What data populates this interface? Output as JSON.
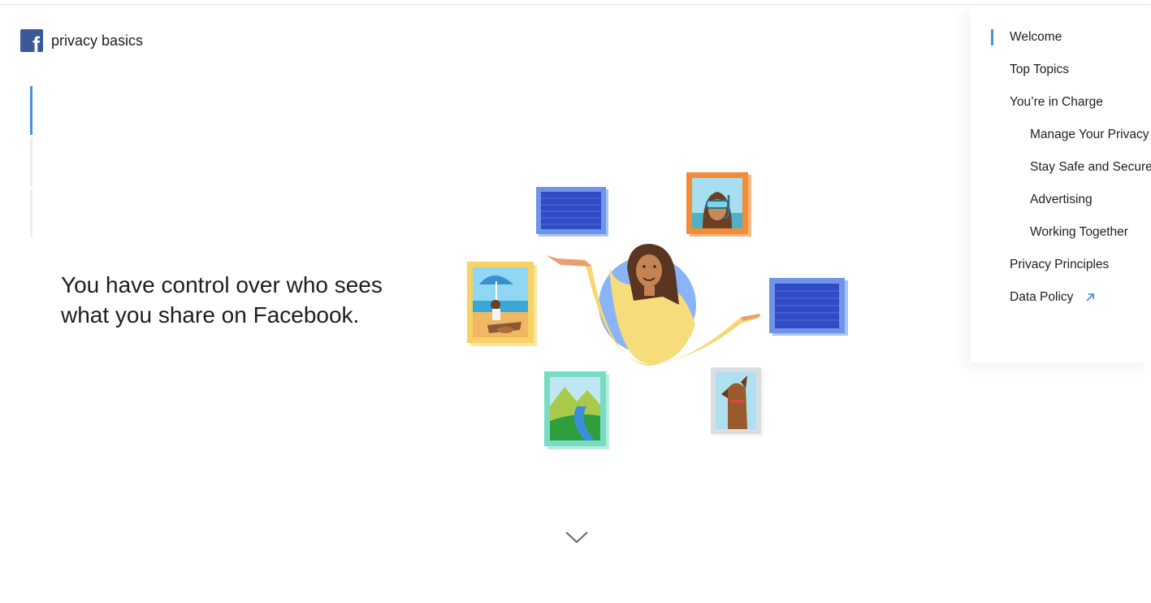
{
  "brand": {
    "name": "privacy basics",
    "logo_letter": "f"
  },
  "progress": {
    "segments": 3,
    "active_index": 0
  },
  "hero": {
    "headline": "You have control over who sees what you share on Facebook."
  },
  "nav": {
    "items": [
      {
        "label": "Welcome",
        "level": 1,
        "active": true
      },
      {
        "label": "Top Topics",
        "level": 1
      },
      {
        "label": "You’re in Charge",
        "level": 1
      },
      {
        "label": "Manage Your Privacy",
        "level": 2
      },
      {
        "label": "Stay Safe and Secure",
        "level": 2
      },
      {
        "label": "Advertising",
        "level": 2
      },
      {
        "label": "Working Together",
        "level": 2
      },
      {
        "label": "Privacy Principles",
        "level": 1
      },
      {
        "label": "Data Policy",
        "level": 1,
        "external": true
      }
    ]
  },
  "colors": {
    "brand": "#3b5998",
    "accent": "#4a90e2",
    "divider": "#dddfe2"
  },
  "icons": {
    "logo": "facebook-logo-icon",
    "scroll": "chevron-down-icon",
    "external": "external-link-arrow-icon"
  }
}
